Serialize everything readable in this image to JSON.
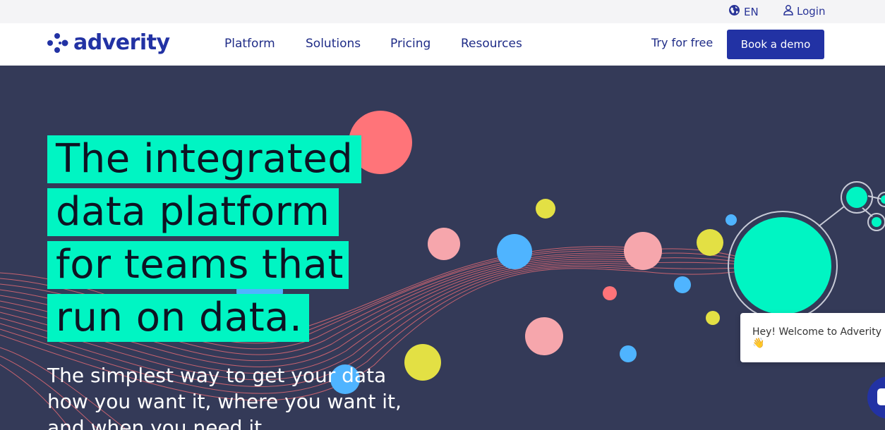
{
  "topbar": {
    "language": "EN",
    "login": "Login"
  },
  "brand": {
    "name": "adverity",
    "color": "#2232a4"
  },
  "nav": {
    "items": [
      "Platform",
      "Solutions",
      "Pricing",
      "Resources"
    ]
  },
  "cta": {
    "try_label": "Try for free",
    "demo_label": "Book a demo"
  },
  "hero": {
    "headline_lines": [
      "The integrated",
      "data platform",
      "for teams that",
      "run on data."
    ],
    "subtitle": "The simplest way to get your data how you want it, where you want it, and when you need it.",
    "background": "#343a58",
    "highlight": "#00f5c3"
  },
  "chat": {
    "greeting": "Hey! Welcome to Adverity 👋"
  }
}
